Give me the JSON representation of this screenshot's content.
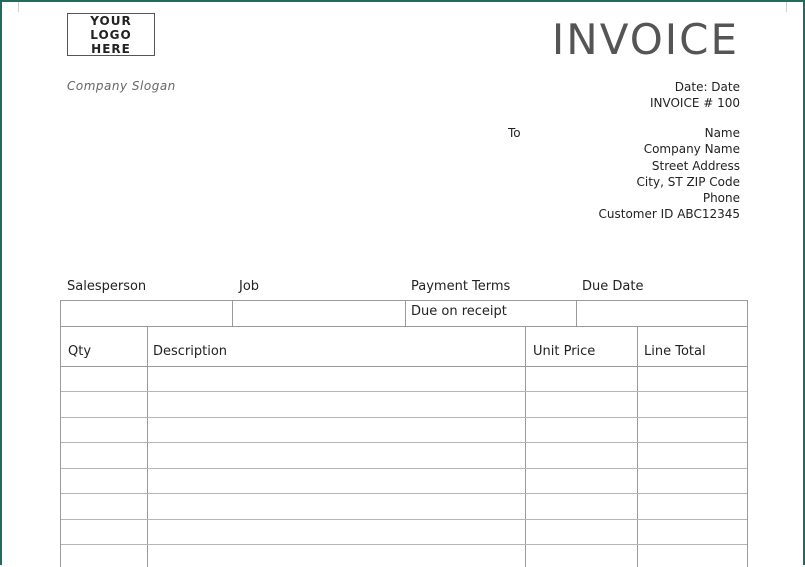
{
  "logo": {
    "text": "YOUR LOGO\nHERE"
  },
  "slogan": "Company Slogan",
  "title": "INVOICE",
  "meta": {
    "date": "Date: Date",
    "invoice_number": "INVOICE # 100"
  },
  "to": {
    "label": "To",
    "name": "Name",
    "company": "Company Name",
    "street": "Street Address",
    "city": "City, ST ZIP Code",
    "phone": "Phone",
    "customer_id": "Customer ID ABC12345"
  },
  "info": {
    "headers": [
      "Salesperson",
      "Job",
      "Payment Terms",
      "Due Date"
    ],
    "values": [
      "",
      "",
      "Due on receipt",
      ""
    ]
  },
  "items": {
    "headers": [
      "Qty",
      "Description",
      "Unit Price",
      "Line Total"
    ],
    "rows": [
      [
        "",
        "",
        "",
        ""
      ],
      [
        "",
        "",
        "",
        ""
      ],
      [
        "",
        "",
        "",
        ""
      ],
      [
        "",
        "",
        "",
        ""
      ],
      [
        "",
        "",
        "",
        ""
      ],
      [
        "",
        "",
        "",
        ""
      ],
      [
        "",
        "",
        "",
        ""
      ],
      [
        "",
        "",
        "",
        ""
      ]
    ]
  },
  "colors": {
    "frame": "#1f6b60",
    "title": "#555555",
    "grid": "#9a9a9a"
  }
}
